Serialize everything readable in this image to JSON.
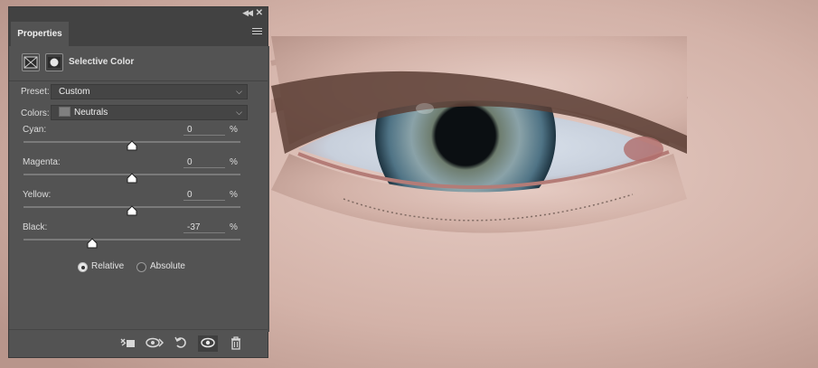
{
  "panel": {
    "tab_label": "Properties",
    "adjustment_title": "Selective Color",
    "preset_label": "Preset:",
    "preset_value": "Custom",
    "colors_label": "Colors:",
    "colors_value": "Neutrals",
    "colors_swatch": "#808080",
    "sliders": [
      {
        "label": "Cyan:",
        "value": "0",
        "unit": "%",
        "fraction": 0.5
      },
      {
        "label": "Magenta:",
        "value": "0",
        "unit": "%",
        "fraction": 0.5
      },
      {
        "label": "Yellow:",
        "value": "0",
        "unit": "%",
        "fraction": 0.5
      },
      {
        "label": "Black:",
        "value": "-37",
        "unit": "%",
        "fraction": 0.315
      }
    ],
    "method_relative": "Relative",
    "method_absolute": "Absolute",
    "method_selected": "Relative"
  },
  "icons": {
    "collapse": "double-chevron-left-icon",
    "close": "close-icon",
    "menu": "hamburger-menu-icon",
    "adjustment": "selective-color-adjustment-icon",
    "mask": "layer-mask-icon",
    "clip": "clip-to-layer-icon",
    "view_previous": "view-previous-state-icon",
    "reset": "reset-icon",
    "visibility": "eye-icon",
    "delete": "trash-icon"
  },
  "colors": {
    "panel_bg": "#535353",
    "tabbar_bg": "#424242",
    "thumb": "#ffffff"
  }
}
